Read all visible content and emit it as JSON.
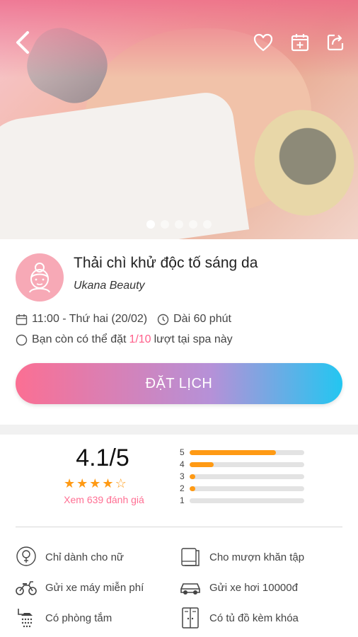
{
  "hero": {
    "slide_count": 5,
    "active_slide": 1
  },
  "header": {
    "back_icon": "chevron-left-icon",
    "actions": [
      "heart-icon",
      "calendar-plus-icon",
      "share-icon"
    ]
  },
  "service": {
    "title": "Thải chì khử độc tố sáng da",
    "brand": "Ukana Beauty",
    "schedule": "11:00 - Thứ hai (20/02)",
    "duration": "Dài 60 phút",
    "availability_prefix": "Bạn còn có thể đặt",
    "availability_count": "1/10",
    "availability_suffix": "lượt tại spa này",
    "book_label": "ĐẶT LỊCH"
  },
  "rating": {
    "score": "4.1/5",
    "stars": 4.1,
    "see_reviews": "Xem 639 đánh giá",
    "bars": [
      {
        "label": "5",
        "fraction": 0.75
      },
      {
        "label": "4",
        "fraction": 0.21
      },
      {
        "label": "3",
        "fraction": 0.05
      },
      {
        "label": "2",
        "fraction": 0.05
      },
      {
        "label": "1",
        "fraction": 0.0
      }
    ]
  },
  "amenities": [
    {
      "label": "Chỉ dành cho nữ",
      "icon": "female-icon"
    },
    {
      "label": "Cho mượn khăn tập",
      "icon": "towel-icon"
    },
    {
      "label": "Gửi xe máy miễn phí",
      "icon": "motorbike-icon"
    },
    {
      "label": "Gửi xe hơi 10000đ",
      "icon": "car-icon"
    },
    {
      "label": "Có phòng tắm",
      "icon": "shower-icon"
    },
    {
      "label": "Có tủ đồ kèm khóa",
      "icon": "locker-icon"
    }
  ],
  "colors": {
    "accent_pink": "#ff5e8a",
    "star_orange": "#ff9a14",
    "gradient_start": "#fb6f93",
    "gradient_end": "#23c6f1"
  }
}
